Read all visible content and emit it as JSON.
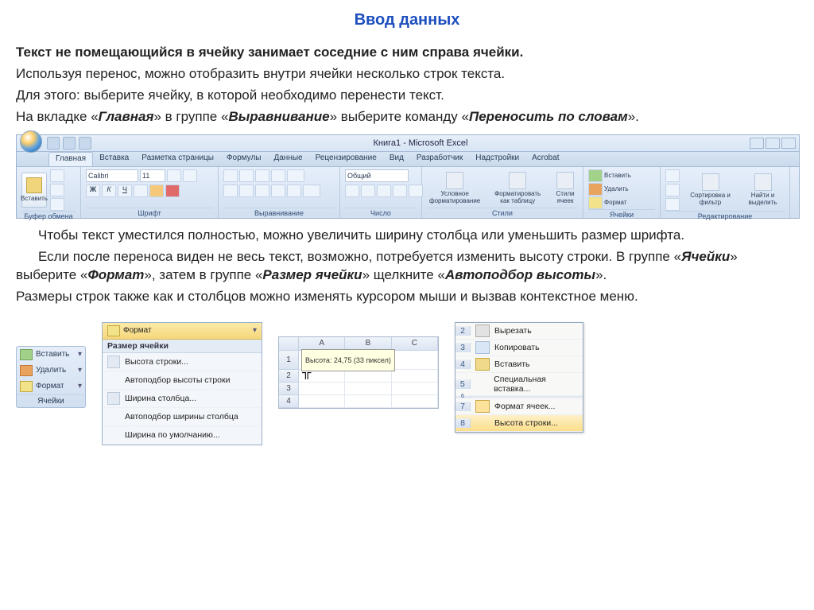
{
  "title": "Ввод данных",
  "para1_bold": "Текст не помещающийся в ячейку занимает соседние с ним справа ячейки.",
  "para2": "Используя перенос, можно отобразить внутри ячейки несколько строк текста.",
  "para3": "Для этого: выберите ячейку, в которой необходимо перенести текст.",
  "para4_a": "На вкладке «",
  "para4_b": "» в группе «",
  "para4_c": "» выберите команду «",
  "para4_d": "».",
  "tab_main": "Главная",
  "grp_align": "Выравнивание",
  "cmd_wrap": "Переносить по словам",
  "ribbon": {
    "doctitle": "Книга1 - Microsoft Excel",
    "tabs": [
      "Главная",
      "Вставка",
      "Разметка страницы",
      "Формулы",
      "Данные",
      "Рецензирование",
      "Вид",
      "Разработчик",
      "Надстройки",
      "Acrobat"
    ],
    "font_name": "Calibri",
    "font_size": "11",
    "number_format": "Общий",
    "group_clipboard": "Буфер обмена",
    "group_font": "Шрифт",
    "group_align": "Выравнивание",
    "group_number": "Число",
    "group_styles": "Стили",
    "group_cells": "Ячейки",
    "group_editing": "Редактирование",
    "btn_paste": "Вставить",
    "btn_cond": "Условное форматирование",
    "btn_table": "Форматировать как таблицу",
    "btn_cellstyle": "Стили ячеек",
    "btn_insert": "Вставить",
    "btn_delete": "Удалить",
    "btn_format": "Формат",
    "btn_sort": "Сортировка и фильтр",
    "btn_find": "Найти и выделить"
  },
  "para5_a": "Чтобы текст уместился полностью, можно увеличить ширину столбца или уменьшить размер шрифта.",
  "para6_a": "Если после переноса виден не весь текст, возможно, потребуется изменить высоту строки. В группе «",
  "para6_b": "» выберите «",
  "para6_c": "», затем в группе «",
  "para6_d": "» щелкните «",
  "para6_e": "».",
  "cells_group": "Ячейки",
  "format_cmd": "Формат",
  "cellsize_group": "Размер ячейки",
  "autofit_cmd": "Автоподбор высоты",
  "para7": "Размеры строк также как и столбцов можно изменять курсором мыши и вызвав контекстное меню.",
  "cellspanel": {
    "insert": "Вставить",
    "delete": "Удалить",
    "format": "Формат",
    "label": "Ячейки"
  },
  "fmtmenu": {
    "header": "Формат",
    "section": "Размер ячейки",
    "items": [
      "Высота строки...",
      "Автоподбор высоты строки",
      "Ширина столбца...",
      "Автоподбор ширины столбца",
      "Ширина по умолчанию..."
    ]
  },
  "sheet": {
    "cols": [
      "A",
      "B",
      "C"
    ],
    "rows": [
      "1",
      "2",
      "3",
      "4"
    ],
    "tooltip": "Высота: 24,75 (33 пиксел)"
  },
  "ctx": {
    "rows": [
      "2",
      "3",
      "4",
      "5",
      "6",
      "7",
      "8"
    ],
    "cut": "Вырезать",
    "copy": "Копировать",
    "paste": "Вставить",
    "pastespecial": "Специальная вставка...",
    "formatcells": "Формат ячеек...",
    "rowheight": "Высота строки..."
  }
}
